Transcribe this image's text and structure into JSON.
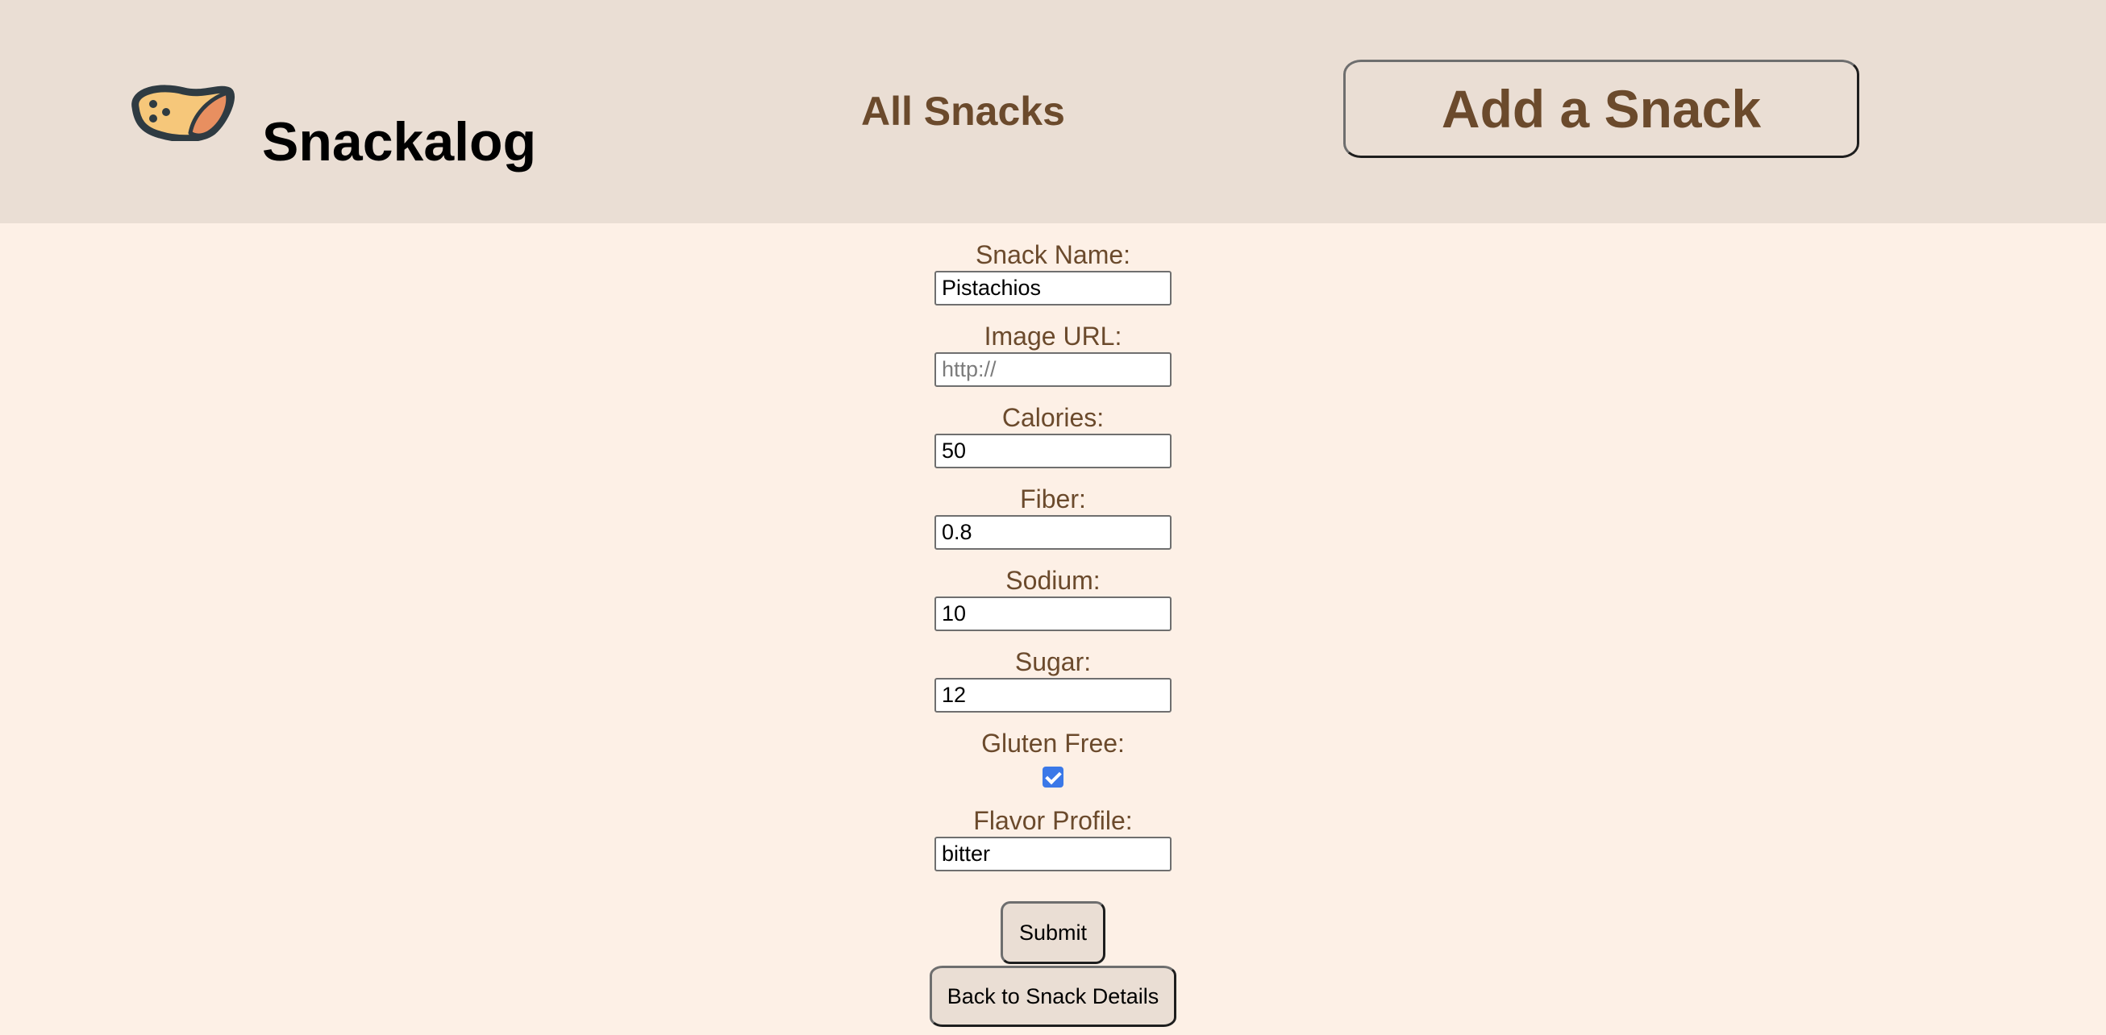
{
  "header": {
    "brand": "Snackalog",
    "logo_icon": "snack-chip-icon",
    "nav_all_snacks": "All Snacks",
    "add_snack_label": "Add a Snack"
  },
  "form": {
    "snack_name": {
      "label": "Snack Name:",
      "value": "Pistachios"
    },
    "image_url": {
      "label": "Image URL:",
      "value": "",
      "placeholder": "http://"
    },
    "calories": {
      "label": "Calories:",
      "value": "50"
    },
    "fiber": {
      "label": "Fiber:",
      "value": "0.8"
    },
    "sodium": {
      "label": "Sodium:",
      "value": "10"
    },
    "sugar": {
      "label": "Sugar:",
      "value": "12"
    },
    "gluten_free": {
      "label": "Gluten Free:",
      "checked": true
    },
    "flavor_profile": {
      "label": "Flavor Profile:",
      "value": "bitter"
    },
    "submit_label": "Submit",
    "back_label": "Back to Snack Details"
  },
  "colors": {
    "header_bg": "#eaded4",
    "page_bg": "#fdf0e6",
    "accent_brown": "#6b4a2c",
    "checkbox_blue": "#3a78e8"
  }
}
